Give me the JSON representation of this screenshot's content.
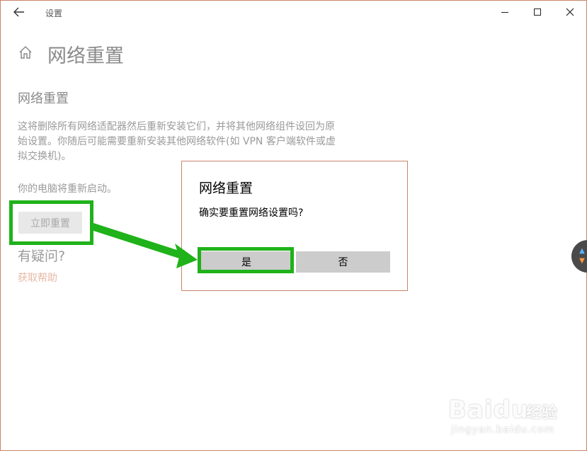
{
  "titlebar": {
    "back_icon": "back-arrow-icon",
    "app_title": "设置",
    "minimize_icon": "minimize-icon",
    "maximize_icon": "maximize-icon",
    "close_icon": "close-icon"
  },
  "header": {
    "home_icon": "home-icon",
    "page_title": "网络重置"
  },
  "main": {
    "section_title": "网络重置",
    "description": "这将删除所有网络适配器然后重新安装它们，并将其他网络组件设回为原始设置。你随后可能需要重新安装其他网络软件(如 VPN 客户端软件或虚拟交换机)。",
    "restart_note": "你的电脑将重新启动。",
    "reset_button": "立即重置",
    "question_title": "有疑问?",
    "help_link": "获取帮助"
  },
  "dialog": {
    "title": "网络重置",
    "message": "确实要重置网络设置吗?",
    "yes_label": "是",
    "no_label": "否"
  },
  "annotation": {
    "highlight_color": "#1fb21a"
  },
  "watermark": {
    "logo_text": "Baidu",
    "product_text": "经验",
    "url_text": "jingyan.baidu.com"
  },
  "colors": {
    "border_accent": "#c8866a",
    "help_link": "#e8b8a4",
    "button_gray": "#cccccc"
  }
}
